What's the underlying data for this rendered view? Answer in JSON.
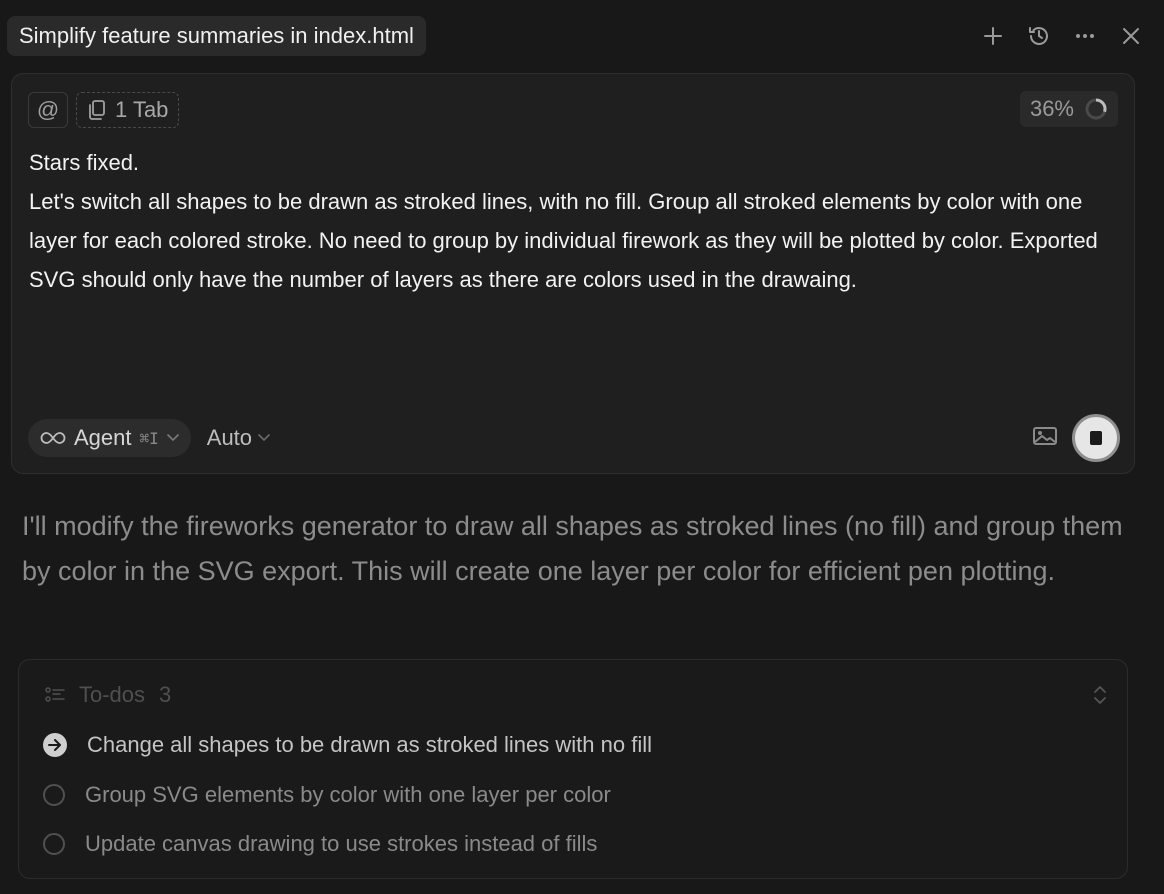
{
  "header": {
    "title": "Simplify feature summaries in index.html",
    "actions": [
      "plus-icon",
      "history-icon",
      "more-icon",
      "close-icon"
    ]
  },
  "composer": {
    "at_symbol": "@",
    "tab_context": "1 Tab",
    "context_usage": "36%",
    "message_lines": [
      "Stars fixed.",
      "Let's switch all shapes to be drawn as stroked lines, with no fill. Group all stroked elements by color with one layer for each colored stroke. No need to group by individual firework as they will be plotted by color. Exported SVG should only have the number of layers as there are colors used in the drawaing."
    ],
    "mode_label": "Agent",
    "mode_shortcut": "⌘I",
    "model_label": "Auto"
  },
  "assistant": {
    "text": "I'll modify the fireworks generator to draw all shapes as stroked lines (no fill) and group them by color in the SVG export. This will create one layer per color for efficient pen plotting."
  },
  "todos": {
    "title": "To-dos",
    "count": "3",
    "items": [
      {
        "label": "Change all shapes to be drawn as stroked lines with no fill",
        "status": "in-progress"
      },
      {
        "label": "Group SVG elements by color with one layer per color",
        "status": "pending"
      },
      {
        "label": "Update canvas drawing to use strokes instead of fills",
        "status": "pending"
      }
    ]
  },
  "colors": {
    "background": "#181818",
    "composer_bg": "#1f1f1f",
    "text_primary": "#f2f2f2",
    "text_muted": "#8c8c8c"
  }
}
